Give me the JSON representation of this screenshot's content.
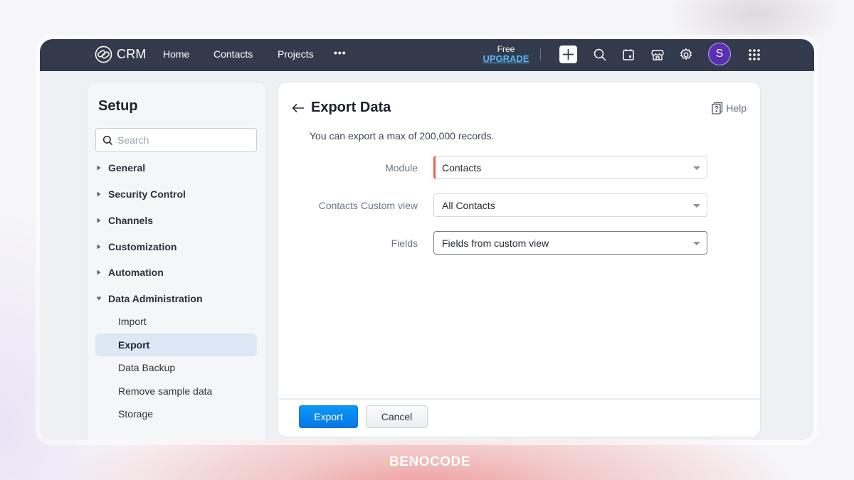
{
  "topbar": {
    "brand": "CRM",
    "nav": [
      "Home",
      "Contacts",
      "Projects"
    ],
    "more_label": "•••",
    "plan_label": "Free",
    "upgrade_label": "UPGRADE",
    "avatar_initial": "S",
    "icons": [
      "plus-icon",
      "search-icon",
      "calendar-icon",
      "marketplace-icon",
      "gear-icon",
      "apps-grid-icon"
    ]
  },
  "sidebar": {
    "title": "Setup",
    "search_placeholder": "Search",
    "sections": [
      {
        "label": "General",
        "expanded": false
      },
      {
        "label": "Security Control",
        "expanded": false
      },
      {
        "label": "Channels",
        "expanded": false
      },
      {
        "label": "Customization",
        "expanded": false
      },
      {
        "label": "Automation",
        "expanded": false
      },
      {
        "label": "Data Administration",
        "expanded": true
      }
    ],
    "sub_items": [
      {
        "label": "Import",
        "active": false
      },
      {
        "label": "Export",
        "active": true
      },
      {
        "label": "Data Backup",
        "active": false
      },
      {
        "label": "Remove sample data",
        "active": false
      },
      {
        "label": "Storage",
        "active": false
      }
    ]
  },
  "main": {
    "title": "Export Data",
    "help_label": "Help",
    "info": "You can export a max of 200,000 records.",
    "fields": [
      {
        "label": "Module",
        "value": "Contacts",
        "required": true
      },
      {
        "label": "Contacts Custom view",
        "value": "All Contacts",
        "required": false
      },
      {
        "label": "Fields",
        "value": "Fields from custom view",
        "required": false
      }
    ],
    "export_label": "Export",
    "cancel_label": "Cancel"
  },
  "watermark": "BENOCODE",
  "colors": {
    "topbar": "#323a4b",
    "primary": "#0a84f0",
    "required": "#f2585b",
    "avatar": "#5b2fb5",
    "upgrade": "#5cb5f5",
    "active_item": "#dce8f5"
  }
}
